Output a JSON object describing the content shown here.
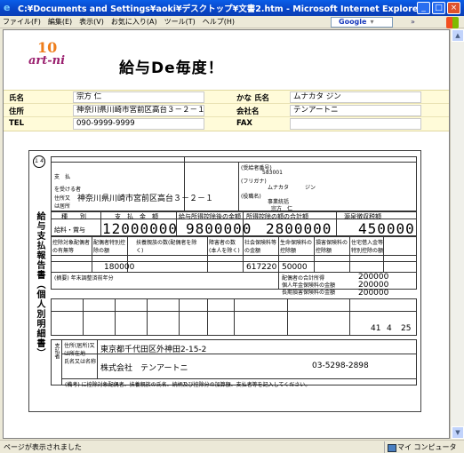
{
  "window": {
    "title": "C:¥Documents and Settings¥aoki¥デスクトップ¥文書2.htm - Microsoft Internet Explorer"
  },
  "menu": [
    "ファイル(F)",
    "編集(E)",
    "表示(V)",
    "お気に入り(A)",
    "ツール(T)",
    "ヘルプ(H)"
  ],
  "toolbar": {
    "google": "Google",
    "links": "»"
  },
  "page": {
    "logo_top": "10",
    "logo_text": "art-ni",
    "title": "給与De毎度！"
  },
  "info": {
    "name_label": "氏名",
    "name_value": "宗方 仁",
    "kana_label": "かな 氏名",
    "kana_value": "ムナカタ ジン",
    "address_label": "住所",
    "address_value": "神奈川県川崎市宮前区高台３－２－１",
    "company_label": "会社名",
    "company_value": "テンアートニ",
    "tel_label": "TEL",
    "tel_value": "090-9999-9999",
    "fax_label": "FAX",
    "fax_value": ""
  },
  "form": {
    "circle_year": "１４",
    "side_title": "給与支払報告書（個人別明細書）",
    "addr_label_1": "支　払",
    "addr_label_2": "を受ける者",
    "addr_label_3": "住所又は居所",
    "address": "神奈川県川崎市宮前区高台３－２－１",
    "person_no_label": "(受給者番号)",
    "person_no": "583001",
    "kana_label": "(フリガナ)",
    "kana": "ムナカタ　　　ジン",
    "role_label": "(役職名)",
    "role": "事業統括",
    "name": "宗方　仁",
    "col_kind": "種　　別",
    "col_pay": "支　払　金　額",
    "col_after": "給与所得控除後の金額",
    "col_deduct": "所得控除の額の合計額",
    "col_tax": "源泉徴収税額",
    "kind_value": "給料・賞与",
    "pay_value": "12000000",
    "after_value": "9800000",
    "deduct_value": "2800000",
    "tax_value": "450000",
    "row2_labels": [
      "控除対象配偶者の有無等",
      "配偶者特別控除の額",
      "扶養親族の数(配偶者を除く)",
      "障害者の数(本人を除く)",
      "社会保険料等の金額",
      "生命保険料の控除額",
      "損害保険料の控除額",
      "住宅借入金等特別控除の額"
    ],
    "social_ins": "617220",
    "life_ins": "50000",
    "spouse_deduct": "180000",
    "summary_label": "(摘要) 年末調整済前年分",
    "right_vals": [
      "200000",
      "200000",
      "200000"
    ],
    "right_labels": [
      "配偶者の合計所得",
      "個人年金保険料の金額",
      "長期損害保険料の金額"
    ],
    "year": "41",
    "month": "4",
    "day": "25",
    "payer_label_addr": "住所(居所)又は所在地",
    "payer_addr": "東京都千代田区外神田2-15-2",
    "payer_label_name": "氏名又は名称",
    "payer_name": "株式会社　テンアートニ",
    "payer_tel": "03-5298-2898",
    "payer_side": "支払者",
    "footer_note": "(備考) に控除対象配偶者、扶養親族の氏名、続柄及び控除分の加算額、支払者等を記入してください。"
  },
  "status": {
    "text": "ページが表示されました",
    "zone": "マイ コンピュータ"
  }
}
